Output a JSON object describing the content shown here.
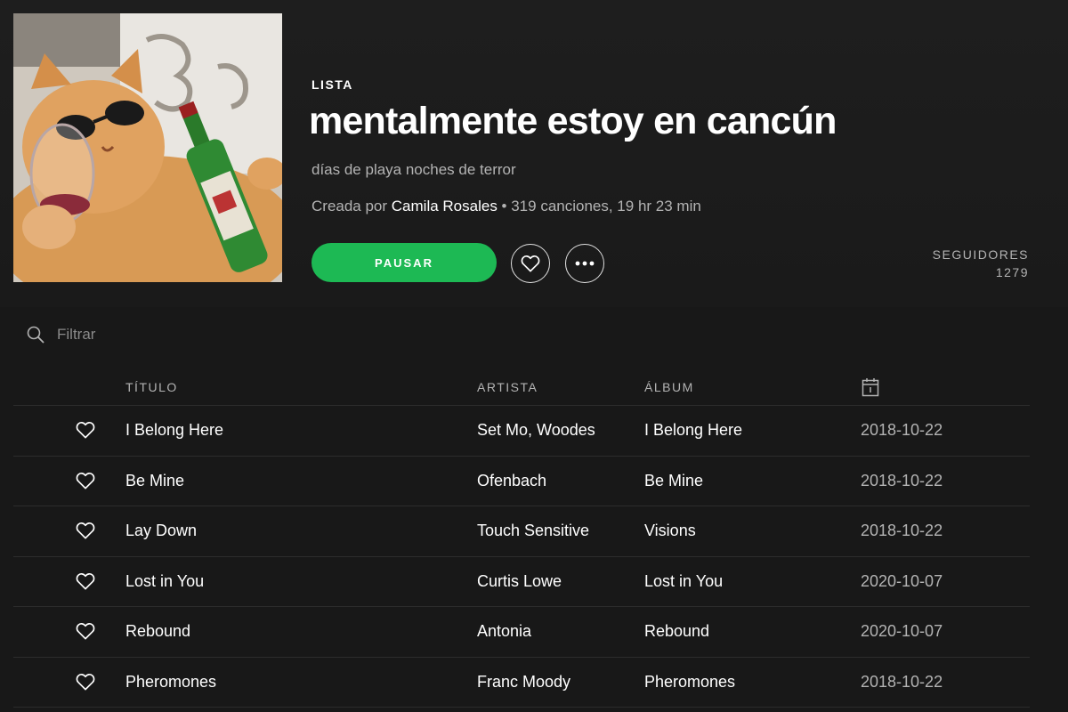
{
  "playlist": {
    "type_label": "LISTA",
    "title": "mentalmente estoy en cancún",
    "description": "días de playa noches de terror",
    "created_by_prefix": "Creada por ",
    "owner": "Camila Rosales",
    "stats": " • 319 canciones, 19 hr 23 min",
    "cover_icon": "cat-with-sunglasses-and-wine-image"
  },
  "actions": {
    "play_label": "PAUSAR",
    "like_icon": "heart-outline-icon",
    "more_icon": "ellipsis-icon"
  },
  "followers": {
    "label": "SEGUIDORES",
    "count": "1279"
  },
  "filter": {
    "placeholder": "Filtrar",
    "icon": "search-icon"
  },
  "columns": {
    "title": "TÍTULO",
    "artist": "ARTISTA",
    "album": "ÁLBUM",
    "date_icon": "calendar-icon"
  },
  "tracks": [
    {
      "title": "I Belong Here",
      "artist": "Set Mo, Woodes",
      "album": "I Belong Here",
      "date": "2018-10-22"
    },
    {
      "title": "Be Mine",
      "artist": "Ofenbach",
      "album": "Be Mine",
      "date": "2018-10-22"
    },
    {
      "title": "Lay Down",
      "artist": "Touch Sensitive",
      "album": "Visions",
      "date": "2018-10-22"
    },
    {
      "title": "Lost in You",
      "artist": "Curtis Lowe",
      "album": "Lost in You",
      "date": "2020-10-07"
    },
    {
      "title": "Rebound",
      "artist": "Antonia",
      "album": "Rebound",
      "date": "2020-10-07"
    },
    {
      "title": "Pheromones",
      "artist": "Franc Moody",
      "album": "Pheromones",
      "date": "2018-10-22"
    }
  ],
  "colors": {
    "accent": "#1db954",
    "background": "#181818",
    "text_primary": "#ffffff",
    "text_secondary": "#b3b3b3"
  }
}
